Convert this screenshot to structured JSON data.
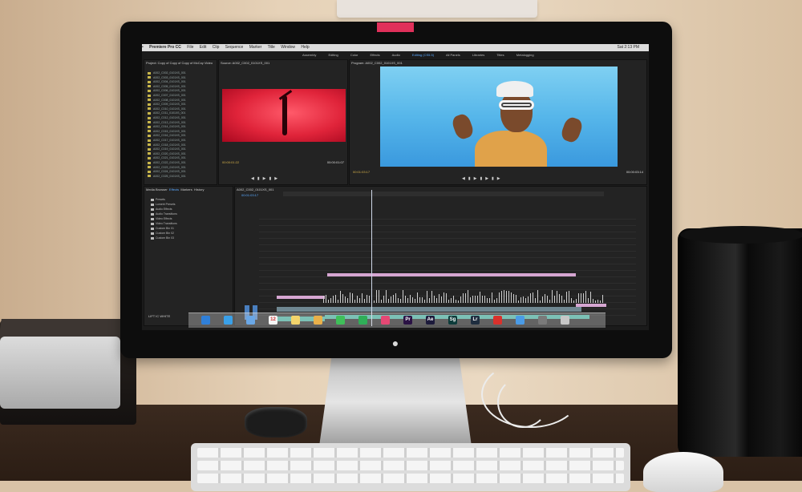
{
  "menubar": {
    "app": "Premiere Pro CC",
    "items": [
      "File",
      "Edit",
      "Clip",
      "Sequence",
      "Marker",
      "Title",
      "Window",
      "Help"
    ],
    "clock": "Sat 2:13 PM"
  },
  "workspaces": [
    "Assembly",
    "Editing",
    "Color",
    "Effects",
    "Audio",
    "Editing (CS5.5)",
    "All Panels",
    "Libraries",
    "Titles",
    "Metalogging"
  ],
  "project_panel": {
    "tab": "Project: Copy of Copy of Copy of McCoy Video",
    "files": [
      "A002_C002_0101XS_001",
      "A002_C003_0101XS_001",
      "A002_C004_0101XS_001",
      "A002_C005_0101XS_001",
      "A002_C006_0101XS_001",
      "A002_C007_0101XS_001",
      "A002_C008_0101XS_001",
      "A002_C009_0101XS_001",
      "A002_C010_0101XS_001",
      "A002_C011_0101XS_001",
      "A002_C012_0101XS_001",
      "A002_C013_0101XS_001",
      "A002_C014_0101XS_001",
      "A002_C015_0101XS_001",
      "A002_C016_0101XS_001",
      "A002_C017_0101XS_001",
      "A002_C018_0101XS_001",
      "A002_C019_0101XS_001",
      "A002_C020_0101XS_001",
      "A002_C021_0101XS_001",
      "A002_C022_0101XS_001",
      "A002_C023_0101XS_001",
      "A002_C024_0101XS_001",
      "A002_C025_0101XS_001"
    ]
  },
  "source_panel": {
    "tab": "Source: A002_C002_0101XS_001",
    "timecode_left": "00:00:01:22",
    "timecode_right": "00:00:01:07"
  },
  "program_panel": {
    "tab": "Program: A002_C002_0101XS_001",
    "timecode_left": "00:01:03:17",
    "timecode_right": "00:00:03:14"
  },
  "effects_panel": {
    "tabs": [
      "Media Browser",
      "Effects",
      "Markers",
      "History"
    ],
    "items": [
      "Presets",
      "Lumetri Presets",
      "Audio Effects",
      "Audio Transitions",
      "Video Effects",
      "Video Transitions",
      "Custom Bin 01",
      "Custom Bin 02",
      "Custom Bin 03"
    ]
  },
  "timeline": {
    "sequence_name": "A002_C002_0101XS_001",
    "timecode": "00:01:03:17"
  },
  "status_text": "LIFT IC WHITE",
  "colors": {
    "accent_blue": "#5aa9ff",
    "timecode_yellow": "#d6b14a",
    "clip_pink": "#d6a6d2",
    "clip_teal": "#49b3a1"
  },
  "dock": [
    {
      "icon": "finder-icon",
      "color": "#2f7fd8",
      "label": ""
    },
    {
      "icon": "safari-icon",
      "color": "#3aa0e8",
      "label": ""
    },
    {
      "icon": "mail-icon",
      "color": "#6aa7e6",
      "label": ""
    },
    {
      "icon": "calendar-icon",
      "color": "#f4f4f4",
      "label": "12"
    },
    {
      "icon": "notes-icon",
      "color": "#f3d46b",
      "label": ""
    },
    {
      "icon": "photos-icon",
      "color": "#e9b04a",
      "label": ""
    },
    {
      "icon": "messages-icon",
      "color": "#3fbf59",
      "label": ""
    },
    {
      "icon": "facetime-icon",
      "color": "#2fae58",
      "label": ""
    },
    {
      "icon": "music-icon",
      "color": "#e54874",
      "label": ""
    },
    {
      "icon": "premiere-icon",
      "color": "#2a1244",
      "label": "Pr"
    },
    {
      "icon": "after-effects-icon",
      "color": "#1c1a3b",
      "label": "Ae"
    },
    {
      "icon": "speedgrade-icon",
      "color": "#0d3b3a",
      "label": "Sg"
    },
    {
      "icon": "lightroom-icon",
      "color": "#1e2d3f",
      "label": "Lr"
    },
    {
      "icon": "creative-cloud-icon",
      "color": "#d9312c",
      "label": ""
    },
    {
      "icon": "app-store-icon",
      "color": "#4a9be6",
      "label": ""
    },
    {
      "icon": "system-preferences-icon",
      "color": "#7a7a7a",
      "label": ""
    },
    {
      "icon": "trash-icon",
      "color": "#c7c7c7",
      "label": ""
    }
  ]
}
